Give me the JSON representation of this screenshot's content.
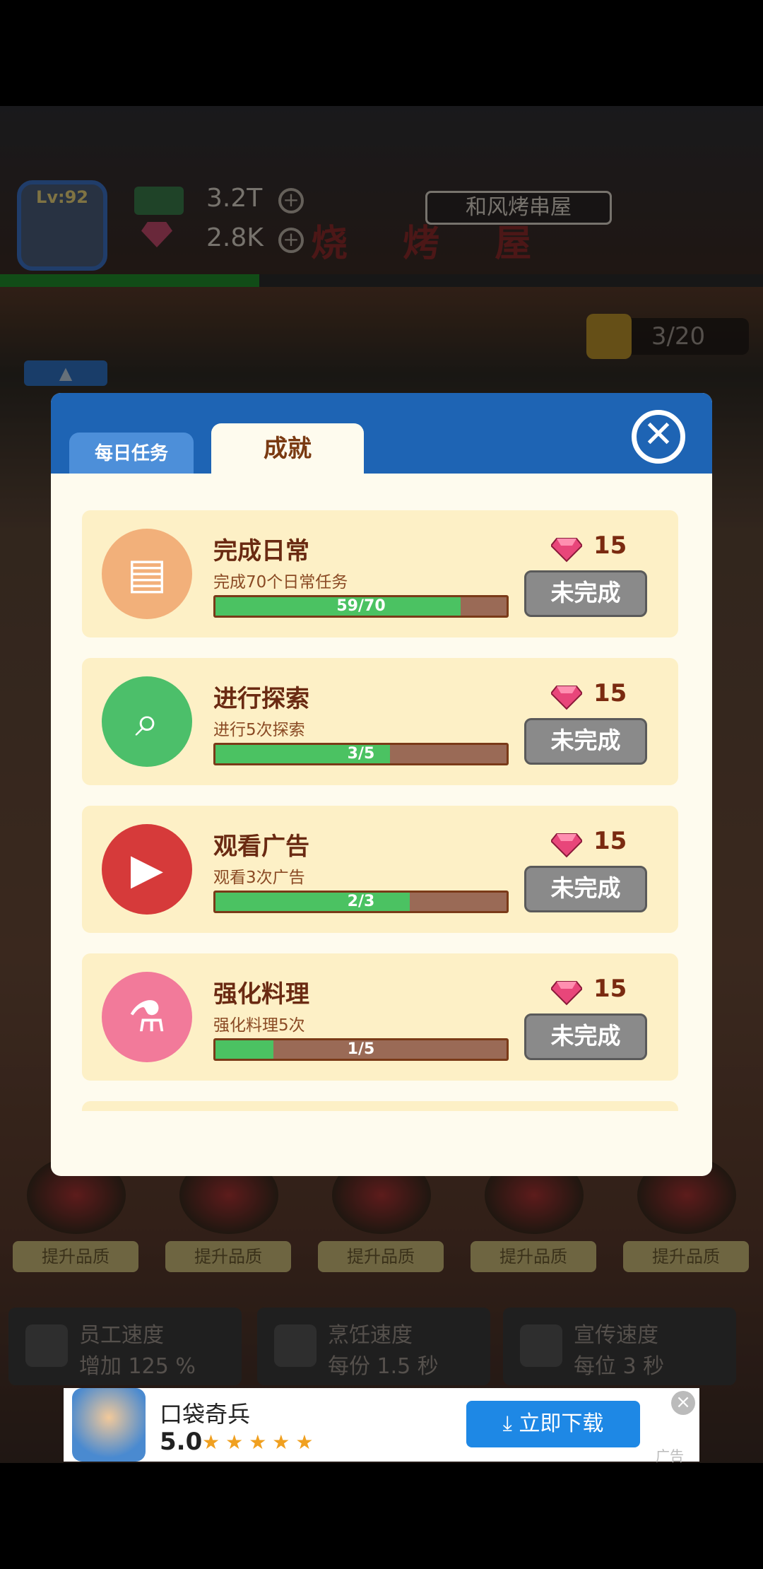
{
  "hud": {
    "level": "Lv:92",
    "cash": "3.2T",
    "gems": "2.8K",
    "shop_sign": "和风烤串屋",
    "shop_banner": "烧 烤 屋",
    "likes": "3/20",
    "xp_fill": 0.34
  },
  "dialog": {
    "tabs": [
      "每日任务",
      "成就"
    ],
    "active_tab": "成就",
    "achievements": [
      {
        "title": "完成日常",
        "desc": "完成70个日常任务",
        "progress": "59/70",
        "fraction": 0.843,
        "reward": "15",
        "status": "未完成",
        "icon": "calendar-icon",
        "icon_color": "#f2b07a"
      },
      {
        "title": "进行探索",
        "desc": "进行5次探索",
        "progress": "3/5",
        "fraction": 0.6,
        "reward": "15",
        "status": "未完成",
        "icon": "map-search-icon",
        "icon_color": "#4cbf6a"
      },
      {
        "title": "观看广告",
        "desc": "观看3次广告",
        "progress": "2/3",
        "fraction": 0.667,
        "reward": "15",
        "status": "未完成",
        "icon": "video-play-icon",
        "icon_color": "#d63a3a"
      },
      {
        "title": "强化料理",
        "desc": "强化料理5次",
        "progress": "1/5",
        "fraction": 0.2,
        "reward": "15",
        "status": "未完成",
        "icon": "salt-shaker-icon",
        "icon_color": "#f27a9a"
      }
    ]
  },
  "upgrades": {
    "button_label": "提升品质",
    "stats": [
      {
        "title": "员工速度",
        "value": "增加 125 %"
      },
      {
        "title": "烹饪速度",
        "value": "每份 1.5 秒"
      },
      {
        "title": "宣传速度",
        "value": "每位 3 秒"
      }
    ]
  },
  "ad": {
    "app_name": "口袋奇兵",
    "rating": "5.0",
    "stars": "★★★★★",
    "download_label": "立即下载",
    "tag": "广告"
  },
  "colors": {
    "dialog_header": "#1e64b4",
    "card_bg": "#fdf0c6",
    "progress_fill": "#4bc262",
    "button_gray": "#8a8a8a"
  }
}
